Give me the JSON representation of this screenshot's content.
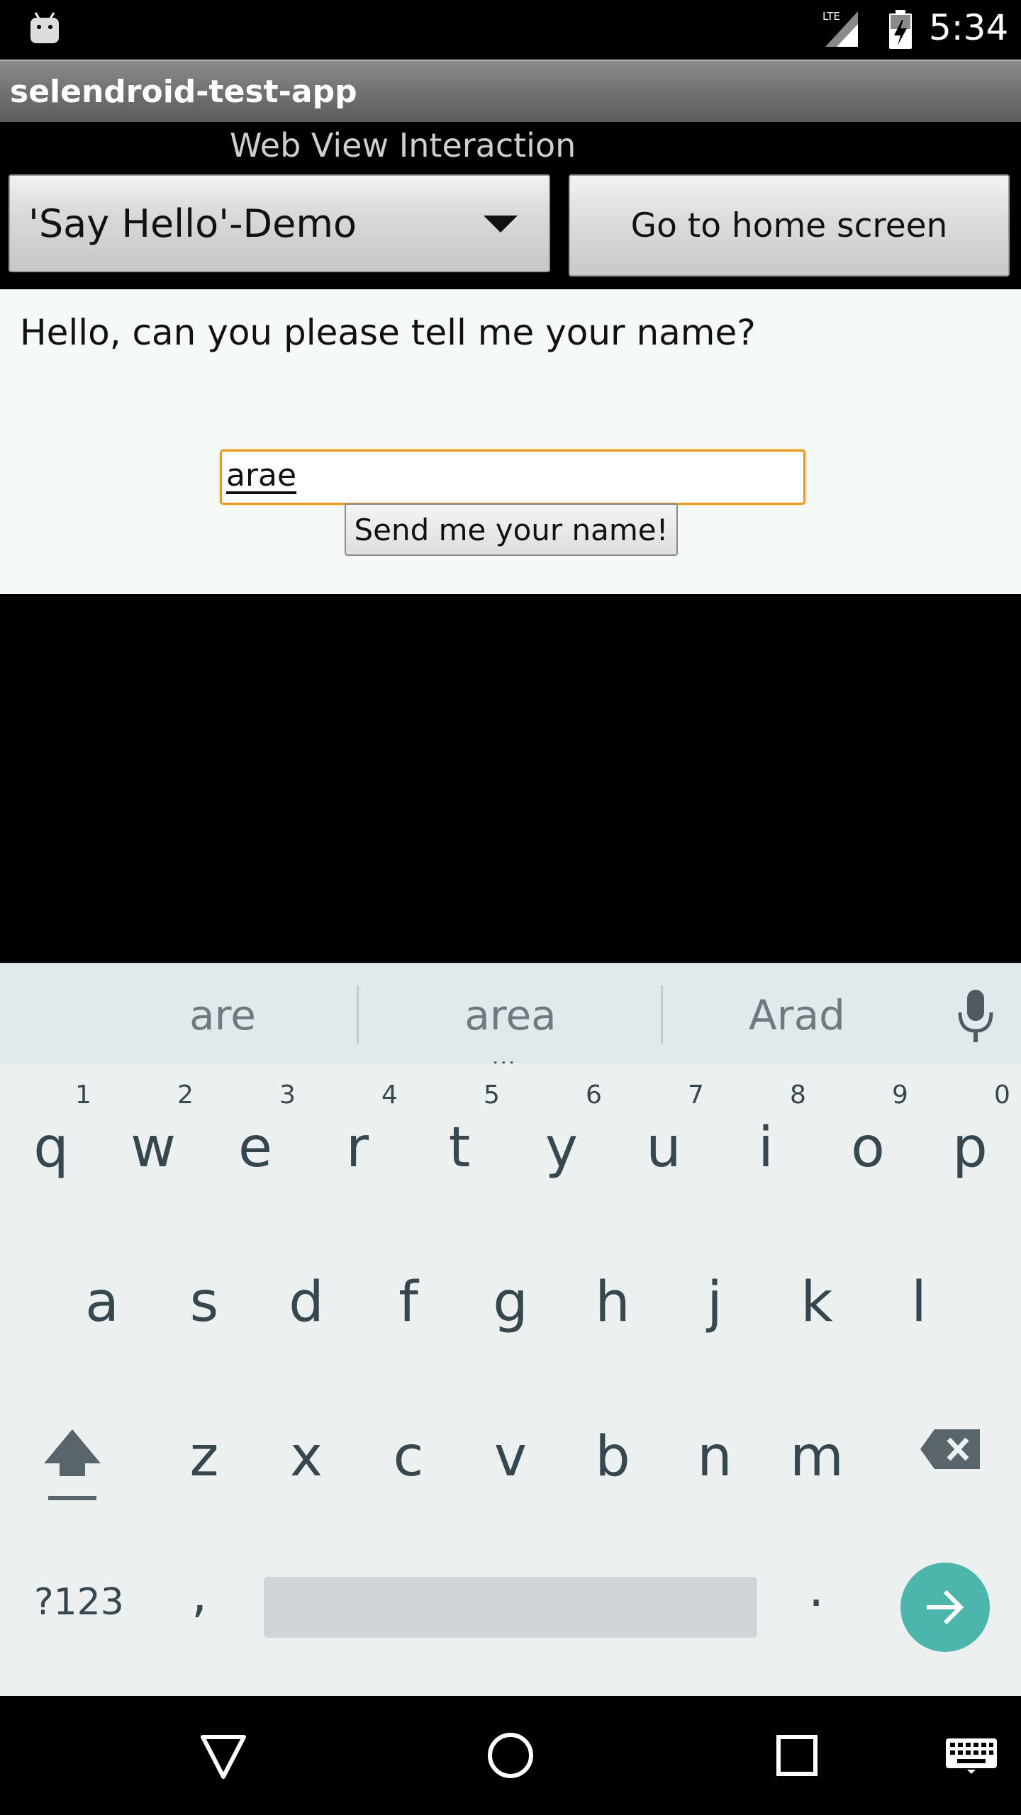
{
  "status_bar": {
    "network_label": "LTE",
    "time": "5:34",
    "icons": [
      "android-debug-icon",
      "lte-signal-icon",
      "battery-charging-icon"
    ]
  },
  "app": {
    "title": "selendroid-test-app"
  },
  "screen": {
    "label": "Web View Interaction",
    "spinner_value": "'Say Hello'-Demo",
    "home_button_label": "Go to home screen"
  },
  "webview": {
    "question": "Hello, can you please tell me your name?",
    "name_input_value": "arae",
    "send_button_label": "Send me your name!",
    "input_focus_color": "#e69a1e"
  },
  "keyboard": {
    "suggestions": [
      "are",
      "area",
      "Arad"
    ],
    "more_suggestions_indicator": "...",
    "row1": [
      {
        "key": "q",
        "hint": "1"
      },
      {
        "key": "w",
        "hint": "2"
      },
      {
        "key": "e",
        "hint": "3"
      },
      {
        "key": "r",
        "hint": "4"
      },
      {
        "key": "t",
        "hint": "5"
      },
      {
        "key": "y",
        "hint": "6"
      },
      {
        "key": "u",
        "hint": "7"
      },
      {
        "key": "i",
        "hint": "8"
      },
      {
        "key": "o",
        "hint": "9"
      },
      {
        "key": "p",
        "hint": "0"
      }
    ],
    "row2": [
      "a",
      "s",
      "d",
      "f",
      "g",
      "h",
      "j",
      "k",
      "l"
    ],
    "row3": [
      "z",
      "x",
      "c",
      "v",
      "b",
      "n",
      "m"
    ],
    "symbols_key": "?123",
    "comma_key": ",",
    "period_key": ".",
    "accent_color": "#4db6ac",
    "icons": [
      "microphone-icon",
      "shift-icon",
      "backspace-icon",
      "enter-arrow-icon"
    ]
  },
  "nav_bar": {
    "icons": [
      "back-icon",
      "home-icon",
      "recents-icon",
      "keyboard-icon"
    ]
  }
}
